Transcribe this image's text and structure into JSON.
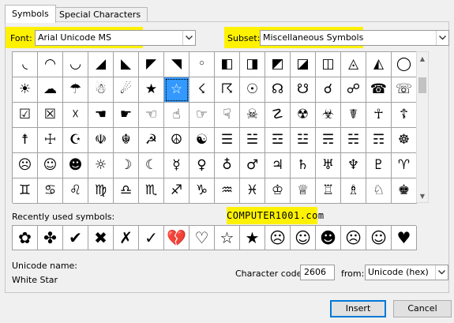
{
  "tabs": [
    {
      "label": "Symbols"
    },
    {
      "label": "Special Characters"
    }
  ],
  "font": {
    "label": "Font:",
    "value": "Arial Unicode MS"
  },
  "subset": {
    "label": "Subset:",
    "value": "Miscellaneous Symbols"
  },
  "symbol_grid": [
    [
      "◟",
      "◠",
      "◡",
      "◢",
      "◣",
      "◤",
      "◥",
      "◦",
      "◧",
      "◨",
      "◩",
      "◪",
      "◫",
      "◬",
      "◭",
      "◯"
    ],
    [
      "☀",
      "☁",
      "☂",
      "☃",
      "☄",
      "★",
      "☆",
      "☇",
      "☈",
      "☉",
      "☊",
      "☋",
      "☌",
      "☍",
      "☎",
      "☏"
    ],
    [
      "☑",
      "☒",
      "☓",
      "☚",
      "☛",
      "☜",
      "☝",
      "☞",
      "☟",
      "☠",
      "☡",
      "☢",
      "☣",
      "☤",
      "☥",
      "☦"
    ],
    [
      "☨",
      "☩",
      "☪",
      "☫",
      "☬",
      "☭",
      "☮",
      "☯",
      "☰",
      "☱",
      "☲",
      "☳",
      "☴",
      "☵",
      "☶",
      "☸"
    ],
    [
      "☹",
      "☺",
      "☻",
      "☼",
      "☽",
      "☾",
      "☿",
      "♀",
      "♁",
      "♂",
      "♃",
      "♄",
      "♅",
      "♆",
      "♇",
      "♈"
    ],
    [
      "♊",
      "♋",
      "♌",
      "♍",
      "♎",
      "♏",
      "♐",
      "♑",
      "♒",
      "♓",
      "♔",
      "♕",
      "♖",
      "♗",
      "♘",
      "♚"
    ]
  ],
  "selected_symbol": "☆",
  "recent": {
    "label": "Recently used symbols:",
    "symbols": [
      "✿",
      "✤",
      "✔",
      "✖",
      "✗",
      "✓",
      "💔",
      "♡",
      "☆",
      "★",
      "☹",
      "☺",
      "☻",
      "☹",
      "☺",
      "♥"
    ]
  },
  "watermark": "COMPUTER1001.com",
  "unicode_name": {
    "label": "Unicode name:",
    "value": "White Star"
  },
  "char_code": {
    "label": "Character code:",
    "value": "2606"
  },
  "from": {
    "label": "from:",
    "value": "Unicode (hex)"
  },
  "buttons": {
    "insert": "Insert",
    "cancel": "Cancel"
  },
  "colors": {
    "highlight": "#fff200",
    "selection": "#3399ff"
  },
  "icons": {
    "dropdown": "chevron-down-icon",
    "scroll_up": "chevron-up-icon",
    "scroll_down": "chevron-down-icon"
  }
}
